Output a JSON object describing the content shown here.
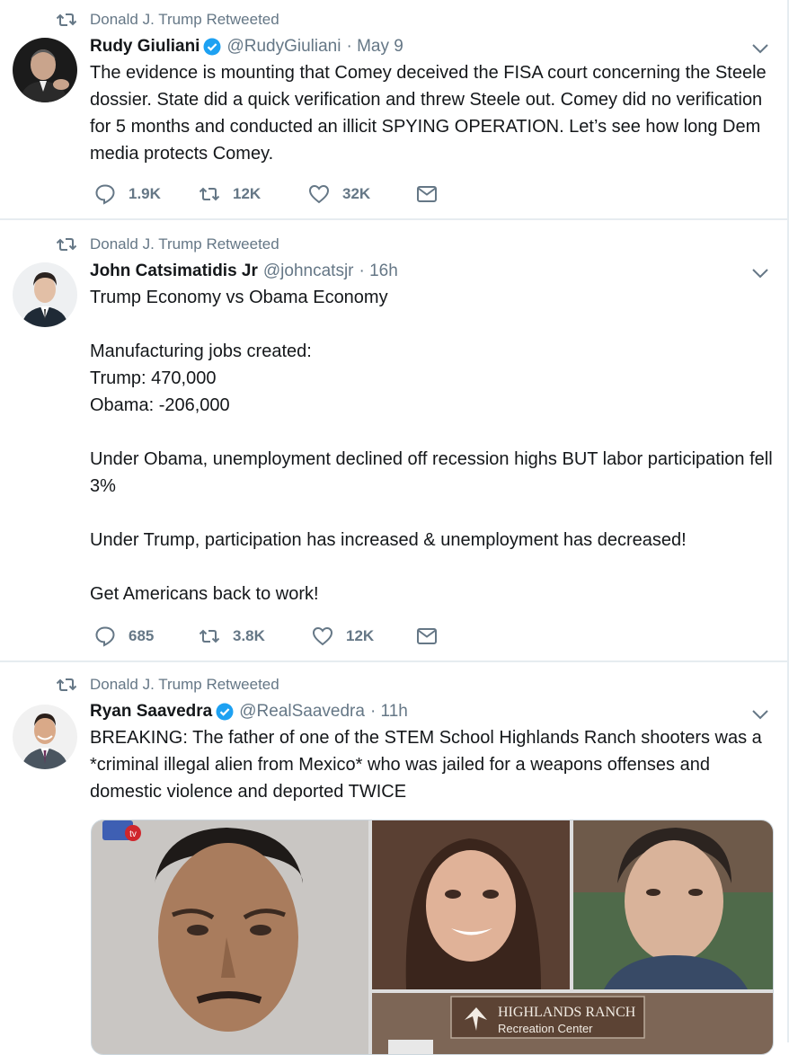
{
  "colors": {
    "muted": "#657786",
    "blue": "#1da1f2",
    "text": "#14171a",
    "divider": "#e6ecf0"
  },
  "tweets": [
    {
      "retweeted_by": "Donald J. Trump Retweeted",
      "name": "Rudy Giuliani",
      "verified": true,
      "handle": "@RudyGiuliani",
      "time": "· May 9",
      "text": "The evidence is mounting that Comey deceived the FISA court concerning the Steele dossier. State did a quick verification and threw Steele out. Comey did no verification  for 5 months and conducted an illicit SPYING OPERATION. Let’s see how long Dem media protects Comey.",
      "replies": "1.9K",
      "retweets": "12K",
      "likes": "32K"
    },
    {
      "retweeted_by": "Donald J. Trump Retweeted",
      "name": "John Catsimatidis Jr",
      "verified": false,
      "handle": "@johncatsjr",
      "time": "· 16h",
      "text": "Trump Economy vs Obama Economy\n\nManufacturing jobs created:\nTrump: 470,000\nObama: -206,000\n\nUnder Obama, unemployment declined off recession highs BUT labor participation fell 3%\n\nUnder Trump, participation has increased & unemployment has decreased!\n\nGet Americans back to work!",
      "replies": "685",
      "retweets": "3.8K",
      "likes": "12K"
    },
    {
      "retweeted_by": "Donald J. Trump Retweeted",
      "name": "Ryan Saavedra",
      "verified": true,
      "handle": "@RealSaavedra",
      "time": "· 11h",
      "text": "BREAKING: The father of one of the STEM School Highlands Ranch shooters was a *criminal illegal alien from Mexico* who was jailed for a weapons offenses and domestic violence and deported TWICE",
      "media": {
        "station_logo": "tv",
        "sign_line1": "HIGHLANDS RANCH",
        "sign_line2": "Recreation Center"
      }
    }
  ]
}
